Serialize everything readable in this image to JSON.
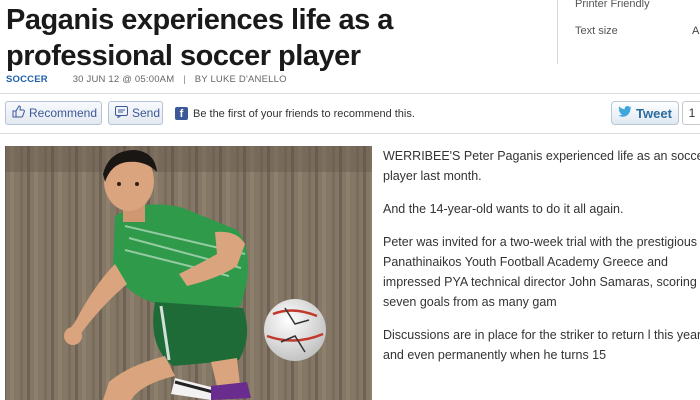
{
  "article": {
    "headline": "Paganis experiences life as a professional soccer player",
    "section": "SOCCER",
    "date": "30 JUN 12 @ 05:00AM",
    "byline": "BY LUKE D'ANELLO",
    "paragraphs": [
      "WERRIBEE'S Peter Paganis experienced life as an soccer player last month.",
      "And the 14-year-old wants to do it all again.",
      "Peter was invited for a two-week trial with the prestigious Panathinaikos Youth Football Academy Greece and impressed PYA technical director John Samaras, scoring seven goals from as many gam",
      "Discussions are in place for the striker to return l this year and even permanently when he turns 15"
    ]
  },
  "tools": {
    "printer_friendly": "Printer Friendly",
    "text_size": "Text size",
    "text_size_option": "A"
  },
  "social": {
    "recommend_label": "Recommend",
    "send_label": "Send",
    "fb_prompt": "Be the first of your friends to recommend this.",
    "tweet_label": "Tweet",
    "tweet_count": "1"
  },
  "icons": {
    "recommend": "thumbs-up-icon",
    "send": "send-icon",
    "facebook": "facebook-icon",
    "twitter": "twitter-bird-icon"
  },
  "colors": {
    "section_link": "#1f5fa8",
    "facebook_blue": "#3b5998",
    "jersey_green": "#2e9a4a"
  }
}
